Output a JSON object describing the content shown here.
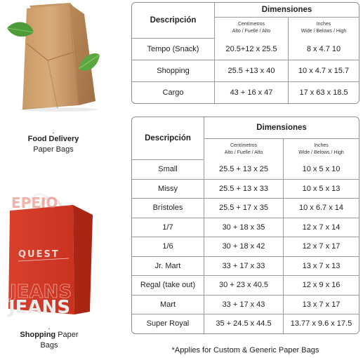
{
  "left": {
    "food": {
      "dot": ".",
      "bold": "Food Delivery",
      "normal": "Paper Bags"
    },
    "shopping": {
      "dot": ".",
      "bold": "Shopping",
      "normal1": " Paper",
      "normal2": "Bags"
    },
    "bag_logo": "QUEST",
    "bag_text": "JEANS"
  },
  "table1": {
    "headers": {
      "descripcion": "Descripción",
      "dimensiones": "Dimensiones",
      "cm_label": "Centímetros",
      "cm_sub": "Alto / Fuelle / Alto",
      "in_label": "Inches",
      "in_sub": "Wide / Belows / High"
    },
    "rows": [
      {
        "name": "Tempo (Snack)",
        "cm": "20.5+12 x 25.5",
        "in": "8 x 4.7 10"
      },
      {
        "name": "Shopping",
        "cm": "25.5 +13 x 40",
        "in": "10 x 4.7 x 15.7"
      },
      {
        "name": "Cargo",
        "cm": "43 + 16 x 47",
        "in": "17 x 63 x 18.5"
      }
    ]
  },
  "table2": {
    "headers": {
      "descripcion": "Descripción",
      "dimensiones": "Dimensiones",
      "cm_label": "Centímetros",
      "cm_sub": "Alto / Fuelle / Alto",
      "in_label": "Inches",
      "in_sub": "Wide / Belows / High"
    },
    "rows": [
      {
        "name": "Small",
        "cm": "25.5 + 13 x 25",
        "in": "10 x 5 x 10"
      },
      {
        "name": "Missy",
        "cm": "25.5 + 13 x 33",
        "in": "10 x 5 x 13"
      },
      {
        "name": "Brístoles",
        "cm": "25.5 + 17 x 35",
        "in": "10 x 6.7 x 14"
      },
      {
        "name": "1/7",
        "cm": "30 + 18 x 35",
        "in": "12 x 7 x 14"
      },
      {
        "name": "1/6",
        "cm": "30 + 18 x 42",
        "in": "12 x 7 x 17"
      },
      {
        "name": "Jr. Mart",
        "cm": "33 + 17 x 33",
        "in": "13 x 7 x 13"
      },
      {
        "name": "Regal (take out)",
        "cm": "30 + 23 x 40.5",
        "in": "12 x 9 x 16"
      },
      {
        "name": "Mart",
        "cm": "33 + 17 x 43",
        "in": "13 x 7 x 17"
      },
      {
        "name": "Super Royal",
        "cm": "35 + 24.5 x 44.5",
        "in": "13.77 x 9.6 x 17.5"
      }
    ]
  },
  "footnote": "*Applies for Custom & Generic Paper Bags"
}
